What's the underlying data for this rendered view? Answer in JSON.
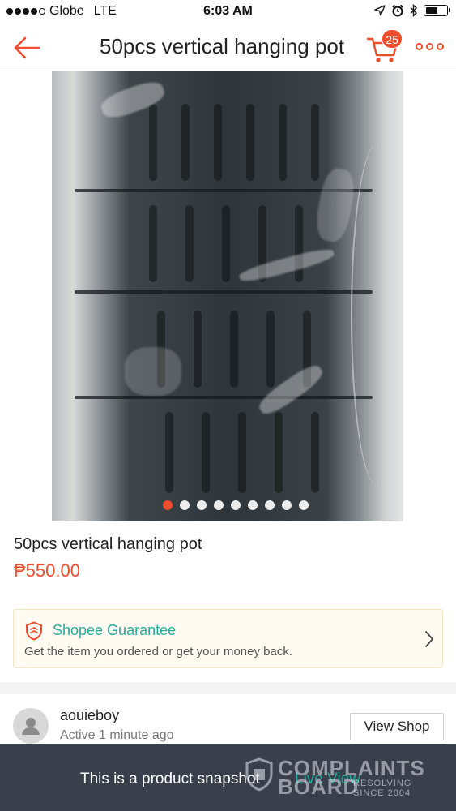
{
  "status_bar": {
    "carrier": "Globe",
    "network": "LTE",
    "time": "6:03 AM",
    "signal_bars": 4,
    "battery_level": 0.6,
    "icons": [
      "location-arrow-icon",
      "alarm-icon",
      "bluetooth-icon",
      "battery-icon"
    ]
  },
  "nav": {
    "title": "50pcs vertical hanging pot",
    "cart_count": "25",
    "accent_color": "#ee4d2d"
  },
  "gallery": {
    "image_count": 9,
    "active_index": 0
  },
  "product": {
    "name": "50pcs vertical hanging pot",
    "price": "₱550.00"
  },
  "guarantee": {
    "title": "Shopee Guarantee",
    "subtitle": "Get the item you ordered or get your money back.",
    "color": "#26aa99"
  },
  "shop": {
    "name": "aouieboy",
    "status": "Active 1 minute ago",
    "view_button": "View Shop"
  },
  "snapshot": {
    "message": "This is a product snapshot",
    "link": "Live View"
  },
  "watermark": {
    "line1": "COMPLAINTS",
    "line2": "BOARD",
    "tagline1": "RESOLVING",
    "tagline2": "SINCE 2004"
  }
}
